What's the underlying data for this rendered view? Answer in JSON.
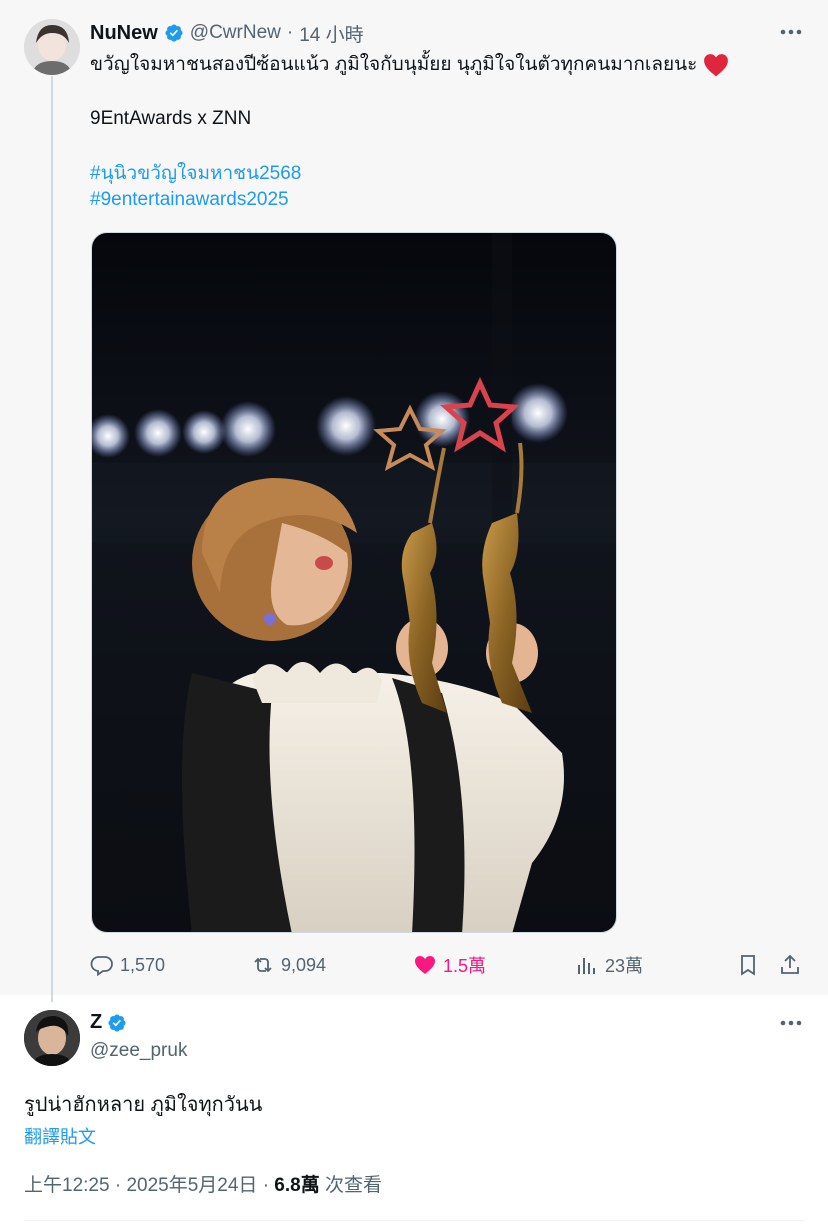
{
  "original_post": {
    "author": {
      "name": "NuNew",
      "handle": "@CwrNew",
      "time_separator": "·",
      "time": "14 小時"
    },
    "text_line1": "ขวัญใจมหาชนสองปีซ้อนแน้ว ภูมิใจกับนุมั้ยย นุภูมิใจในตัวทุกคนมากเลยนะ",
    "text_line2": "9EntAwards x ZNN",
    "hashtags": [
      "#นุนิวขวัญใจมหาชน2568",
      "#9entertainawards2025"
    ],
    "stats": {
      "replies": "1,570",
      "reposts": "9,094",
      "likes": "1.5萬",
      "views": "23萬"
    },
    "colors": {
      "liked": "#f91880",
      "link": "#1d9bf0",
      "verified": "#1d9bf0"
    }
  },
  "reply_post": {
    "author": {
      "name": "Z",
      "handle": "@zee_pruk"
    },
    "text": "รูปน่าฮักหลาย ภูมิใจทุกวันน",
    "translate_label": "翻譯貼文",
    "time": "上午12:25",
    "separator1": "·",
    "date": "2025年5月24日",
    "separator2": "·",
    "views_count": "6.8萬",
    "views_label": "次查看"
  }
}
